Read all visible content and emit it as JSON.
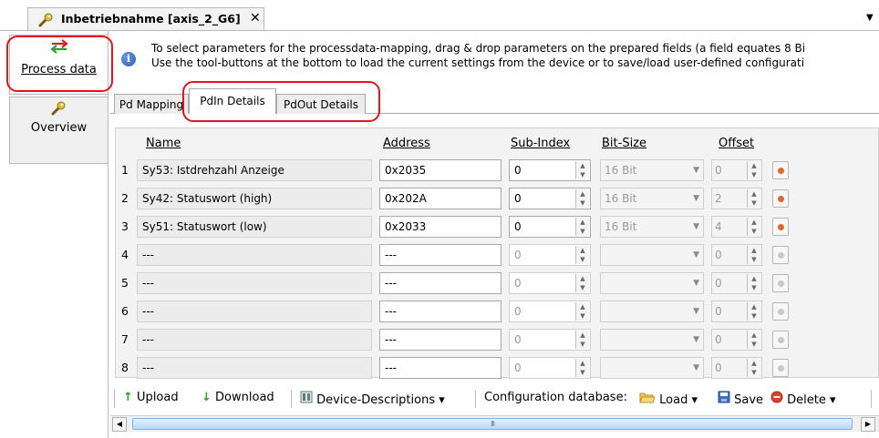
{
  "document_tab": {
    "title": "Inbetriebnahme [axis_2_G6]",
    "close": "✕",
    "menu_glyph": "▼"
  },
  "sidebar": {
    "items": [
      {
        "label": "Process data",
        "icon": "arrows-exchange-icon"
      },
      {
        "label": "Overview",
        "icon": "wrench-icon"
      }
    ]
  },
  "info": {
    "icon": "i",
    "line1": "To select parameters for the processdata-mapping, drag & drop parameters on the prepared fields (a field equates 8 Bi",
    "line2": "Use the tool-buttons at the bottom to load the current settings from the device or to save/load user-defined configurati"
  },
  "tabs": [
    "Pd Mapping",
    "PdIn Details",
    "PdOut Details"
  ],
  "grid": {
    "headers": {
      "name": "Name",
      "address": "Address",
      "subindex": "Sub-Index",
      "bitsize": "Bit-Size",
      "offset": "Offset"
    },
    "rows": [
      {
        "num": "1",
        "name": "Sy53: Istdrehzahl Anzeige",
        "address": "0x2035",
        "subindex": "0",
        "bitsize": "16 Bit",
        "offset": "0",
        "active": true
      },
      {
        "num": "2",
        "name": "Sy42: Statuswort (high)",
        "address": "0x202A",
        "subindex": "0",
        "bitsize": "16 Bit",
        "offset": "2",
        "active": true
      },
      {
        "num": "3",
        "name": "Sy51: Statuswort (low)",
        "address": "0x2033",
        "subindex": "0",
        "bitsize": "16 Bit",
        "offset": "4",
        "active": true
      },
      {
        "num": "4",
        "name": "---",
        "address": "---",
        "subindex": "0",
        "bitsize": "",
        "offset": "0",
        "active": false
      },
      {
        "num": "5",
        "name": "---",
        "address": "---",
        "subindex": "0",
        "bitsize": "",
        "offset": "0",
        "active": false
      },
      {
        "num": "6",
        "name": "---",
        "address": "---",
        "subindex": "0",
        "bitsize": "",
        "offset": "0",
        "active": false
      },
      {
        "num": "7",
        "name": "---",
        "address": "---",
        "subindex": "0",
        "bitsize": "",
        "offset": "0",
        "active": false
      },
      {
        "num": "8",
        "name": "---",
        "address": "---",
        "subindex": "0",
        "bitsize": "",
        "offset": "0",
        "active": false
      }
    ]
  },
  "toolbar": {
    "upload": "Upload",
    "download": "Download",
    "device_descriptions": "Device-Descriptions",
    "config_db": "Configuration database:",
    "load": "Load",
    "save": "Save",
    "delete": "Delete",
    "dropdown": "▾"
  },
  "scrollbar": {
    "grip": "III"
  },
  "colors": {
    "highlight": "#e6141c",
    "active_dot": "#e06a2a",
    "inactive_dot": "#c8c8c8"
  }
}
